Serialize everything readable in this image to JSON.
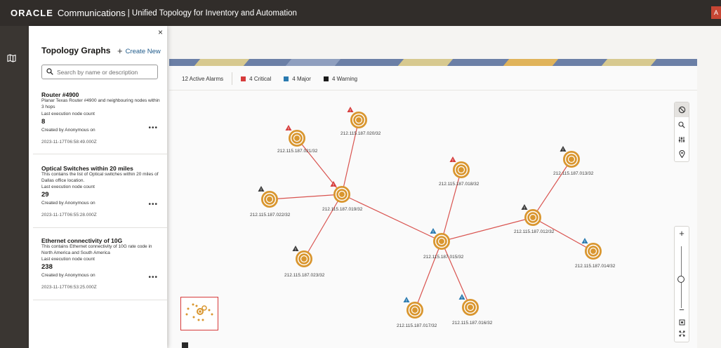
{
  "header": {
    "brand": "ORACLE",
    "product": "Communications",
    "app_title": "| Unified Topology for Inventory and Automation",
    "avatar": "A"
  },
  "navrail": {
    "icon": "map-icon"
  },
  "drawer": {
    "title": "Topology Graphs",
    "create_label": "Create New",
    "close": "×",
    "search_placeholder": "Search by name or description",
    "cards": [
      {
        "title": "Router #4900",
        "description": "Planar Texas Router #4900 and neighbouring nodes within 3 hops",
        "count_label": "Last execution node count",
        "count": "8",
        "created_by": "Created by Anonymous on",
        "timestamp": "2023-11-17T06:58:49.000Z"
      },
      {
        "title": "Optical Switches within 20 miles",
        "description": "This contains the list of Optical switches within 20 miles of Dallas office location.",
        "count_label": "Last execution node count",
        "count": "29",
        "created_by": "Created by Anonymous on",
        "timestamp": "2023-11-17T06:55:28.000Z"
      },
      {
        "title": "Ethernet connectivity of 10G",
        "description": "This contains Ethernet connectivity of 10G rate code in North America and South America",
        "count_label": "Last execution node count",
        "count": "238",
        "created_by": "Created by Anonymous on",
        "timestamp": "2023-11-17T06:53:25.000Z"
      }
    ]
  },
  "alarms": {
    "total": "12 Active Alarms",
    "items": [
      {
        "label": "4 Critical",
        "color": "#d63b3b"
      },
      {
        "label": "4 Major",
        "color": "#2a7ab0"
      },
      {
        "label": "4 Warning",
        "color": "#1a1a1a"
      }
    ]
  },
  "colors": {
    "node": "#d9962f",
    "edge": "#d9534f",
    "critical": "#d63b3b",
    "major": "#2a7ab0",
    "warning": "#3a3a3a"
  },
  "graph": {
    "nodes": [
      {
        "label": "212.115.187.021/32",
        "alarm": "critical"
      },
      {
        "label": "212.115.187.020/32",
        "alarm": "critical"
      },
      {
        "label": "212.115.187.019/32",
        "alarm": "critical"
      },
      {
        "label": "212.115.187.022/32",
        "alarm": "warning"
      },
      {
        "label": "212.115.187.023/32",
        "alarm": "warning"
      },
      {
        "label": "212.115.187.018/32",
        "alarm": "critical"
      },
      {
        "label": "212.115.187.015/32",
        "alarm": "major"
      },
      {
        "label": "212.115.187.013/32",
        "alarm": "warning"
      },
      {
        "label": "212.115.187.012/32",
        "alarm": "warning"
      },
      {
        "label": "212.115.187.014/32",
        "alarm": "major"
      },
      {
        "label": "212.115.187.017/32",
        "alarm": "major"
      },
      {
        "label": "212.115.187.016/32",
        "alarm": "major"
      }
    ],
    "edges": [
      [
        0,
        2
      ],
      [
        1,
        2
      ],
      [
        3,
        2
      ],
      [
        4,
        2
      ],
      [
        2,
        6
      ],
      [
        5,
        6
      ],
      [
        6,
        8
      ],
      [
        8,
        7
      ],
      [
        8,
        9
      ],
      [
        6,
        10
      ],
      [
        6,
        11
      ]
    ]
  },
  "toolbar": {
    "buttons": [
      "reset-icon",
      "search-icon",
      "filter-sliders-icon",
      "location-pin-icon"
    ]
  },
  "zoom": {
    "plus": "+",
    "minus": "−",
    "level": 0.47
  }
}
